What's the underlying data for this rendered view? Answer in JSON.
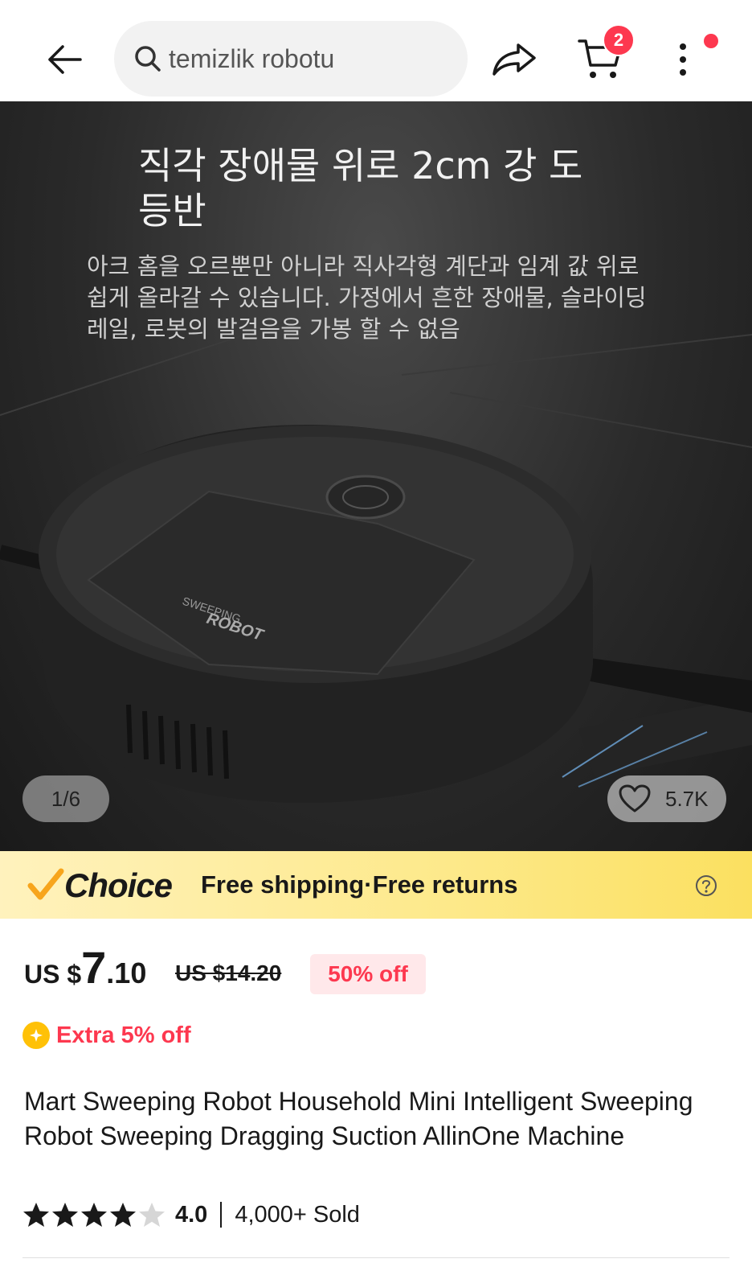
{
  "header": {
    "search_value": "temizlik robotu",
    "cart_count": "2"
  },
  "hero": {
    "title": "직각 장애물 위로 2cm 강 도 등반",
    "description": "아크 홈을 오르뿐만 아니라 직사각형 계단과 임계 값 위로 쉽게 올라갈 수 있습니다. 가정에서 흔한 장애물, 슬라이딩 레일, 로봇의 발걸음을 가봉 할 수 없음",
    "product_label_line1": "SWEEPING",
    "product_label_line2": "ROBOT",
    "page_indicator": "1/6",
    "wishlist_count": "5.7K"
  },
  "choice": {
    "logo_text": "Choice",
    "shipping_text": "Free shipping·Free returns"
  },
  "price": {
    "currency": "US $",
    "integer": "7",
    "decimal": ".10",
    "original": "US $14.20",
    "discount": "50% off"
  },
  "extra_off": "Extra 5% off",
  "product": {
    "title": "Mart Sweeping Robot Household Mini Intelligent Sweeping Robot Sweeping Dragging Suction AllinOne Machine",
    "rating": "4.0",
    "rating_stars_filled": 4,
    "sold": "4,000+ Sold"
  },
  "colors": {
    "accent": "#fd384f",
    "choice_banner": "#fde98a",
    "choice_check": "#f7a51c"
  }
}
